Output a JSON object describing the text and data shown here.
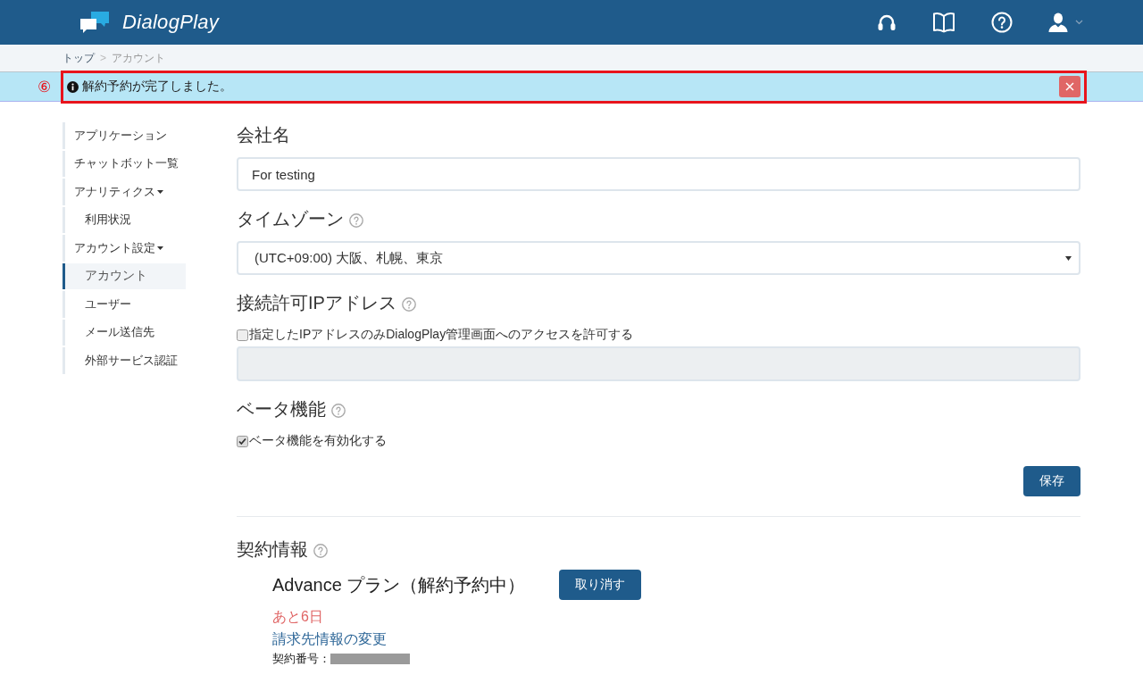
{
  "header": {
    "logo": "DialogPlay"
  },
  "breadcrumb": {
    "items": [
      {
        "label": "トップ",
        "current": false
      },
      {
        "label": "アカウント",
        "current": true
      }
    ],
    "separator": ">"
  },
  "annotation": {
    "label": "⑥"
  },
  "alert": {
    "message": "解約予約が完了しました。"
  },
  "sidebar": {
    "items": [
      {
        "label": "アプリケーション",
        "selected": false
      },
      {
        "label": "チャットボット一覧",
        "selected": false
      },
      {
        "label": "アナリティクス",
        "selected": false,
        "expanded": true,
        "children": [
          {
            "label": "利用状況",
            "selected": false
          }
        ]
      },
      {
        "label": "アカウント設定",
        "selected": false,
        "expanded": true,
        "children": [
          {
            "label": "アカウント",
            "selected": true
          },
          {
            "label": "ユーザー",
            "selected": false
          },
          {
            "label": "メール送信先",
            "selected": false
          },
          {
            "label": "外部サービス認証",
            "selected": false
          }
        ]
      }
    ]
  },
  "settings": [
    {
      "kind": "text",
      "label": "会社名",
      "value": "For testing"
    },
    {
      "kind": "select",
      "label": "タイムゾーン",
      "help": true,
      "value": "(UTC+09:00) 大阪、札幌、東京"
    },
    {
      "kind": "checkbox_field",
      "label": "接続許可IPアドレス",
      "help": true,
      "checkbox": {
        "label": "指定したIPアドレスのみDialogPlay管理画面へのアクセスを許可する",
        "checked": false
      },
      "field": {
        "disabled": true
      }
    },
    {
      "kind": "checkbox",
      "label": "ベータ機能",
      "help": true,
      "checkbox": {
        "label": "ベータ機能を有効化する",
        "checked": true
      }
    }
  ],
  "save_button": "保存",
  "contract": {
    "title": "契約情報",
    "help": true,
    "plan": "Advance プラン（解約予約中）",
    "cancel_button": "取り消す",
    "remaining": "あと6日",
    "billing_link": "請求先情報の変更",
    "number_label": "契約番号："
  }
}
